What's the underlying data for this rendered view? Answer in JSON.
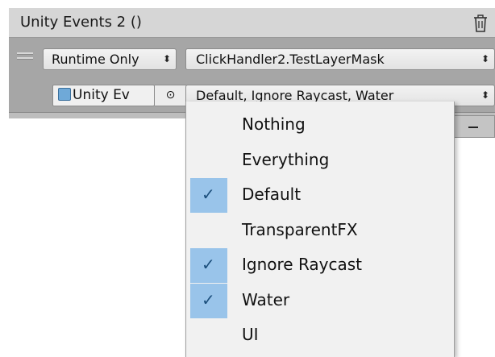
{
  "header": {
    "title": "Unity Events 2 ()"
  },
  "event": {
    "runtime_label": "Runtime Only",
    "function_label": "ClickHandler2.TestLayerMask",
    "object_label": "Unity Ev",
    "mask_label": "Default, Ignore Raycast, Water"
  },
  "dropdown": {
    "items": [
      {
        "label": "Nothing",
        "checked": false
      },
      {
        "label": "Everything",
        "checked": false
      },
      {
        "label": "Default",
        "checked": true
      },
      {
        "label": "TransparentFX",
        "checked": false
      },
      {
        "label": "Ignore Raycast",
        "checked": true
      },
      {
        "label": "Water",
        "checked": true
      },
      {
        "label": "UI",
        "checked": false
      }
    ]
  },
  "icons": {
    "trash": "trash-icon",
    "grip": "drag-handle-icon",
    "picker": "object-picker-icon",
    "popup": "popup-arrows-icon",
    "check": "checkmark-icon",
    "remove": "minus-icon"
  },
  "colors": {
    "selection": "#99c4ea",
    "panel": "#a6a6a6",
    "header": "#d6d6d6",
    "menu": "#f1f1f1"
  }
}
